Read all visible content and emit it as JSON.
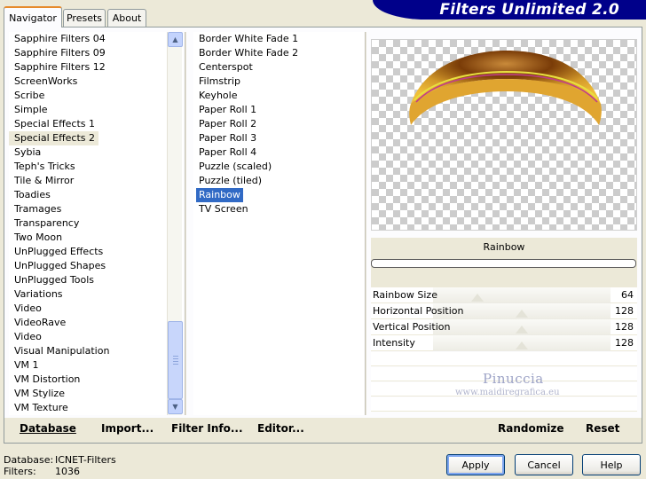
{
  "tabs": [
    {
      "label": "Navigator"
    },
    {
      "label": "Presets"
    },
    {
      "label": "About"
    }
  ],
  "banner": {
    "title": "Filters Unlimited 2.0"
  },
  "categories": [
    "Sapphire Filters 04",
    "Sapphire Filters 09",
    "Sapphire Filters 12",
    "ScreenWorks",
    "Scribe",
    "Simple",
    "Special Effects 1",
    "Special Effects 2",
    "Sybia",
    "Teph's Tricks",
    "Tile & Mirror",
    "Toadies",
    "Tramages",
    "Transparency",
    "Two Moon",
    "UnPlugged Effects",
    "UnPlugged Shapes",
    "UnPlugged Tools",
    "Variations",
    "Video",
    "VideoRave",
    "Video",
    "Visual Manipulation",
    "VM 1",
    "VM Distortion",
    "VM Stylize",
    "VM Texture"
  ],
  "categories_selected_index": 7,
  "filters": [
    "Border White Fade 1",
    "Border White Fade 2",
    "Centerspot",
    "Filmstrip",
    "Keyhole",
    "Paper Roll 1",
    "Paper Roll 2",
    "Paper Roll 3",
    "Paper Roll 4",
    "Puzzle (scaled)",
    "Puzzle (tiled)",
    "Rainbow",
    "TV Screen"
  ],
  "filters_selected_index": 11,
  "preview": {
    "filter_name": "Rainbow"
  },
  "params": [
    {
      "label": "Rainbow Size",
      "value": "64",
      "level": 0.25
    },
    {
      "label": "Horizontal Position",
      "value": "128",
      "level": 0.5
    },
    {
      "label": "Vertical Position",
      "value": "128",
      "level": 0.5
    },
    {
      "label": "Intensity",
      "value": "128",
      "level": 0.5
    }
  ],
  "watermark": {
    "name": "Pinuccia",
    "site": "www.maidiregrafica.eu"
  },
  "actions": {
    "database": "Database",
    "import": "Import...",
    "filter_info": "Filter Info...",
    "editor": "Editor...",
    "randomize": "Randomize",
    "reset": "Reset"
  },
  "info": {
    "database_label": "Database:",
    "database_value": "ICNET-Filters",
    "filters_label": "Filters:",
    "filters_value": "1036"
  },
  "buttons": {
    "apply": "Apply",
    "cancel": "Cancel",
    "help": "Help"
  }
}
